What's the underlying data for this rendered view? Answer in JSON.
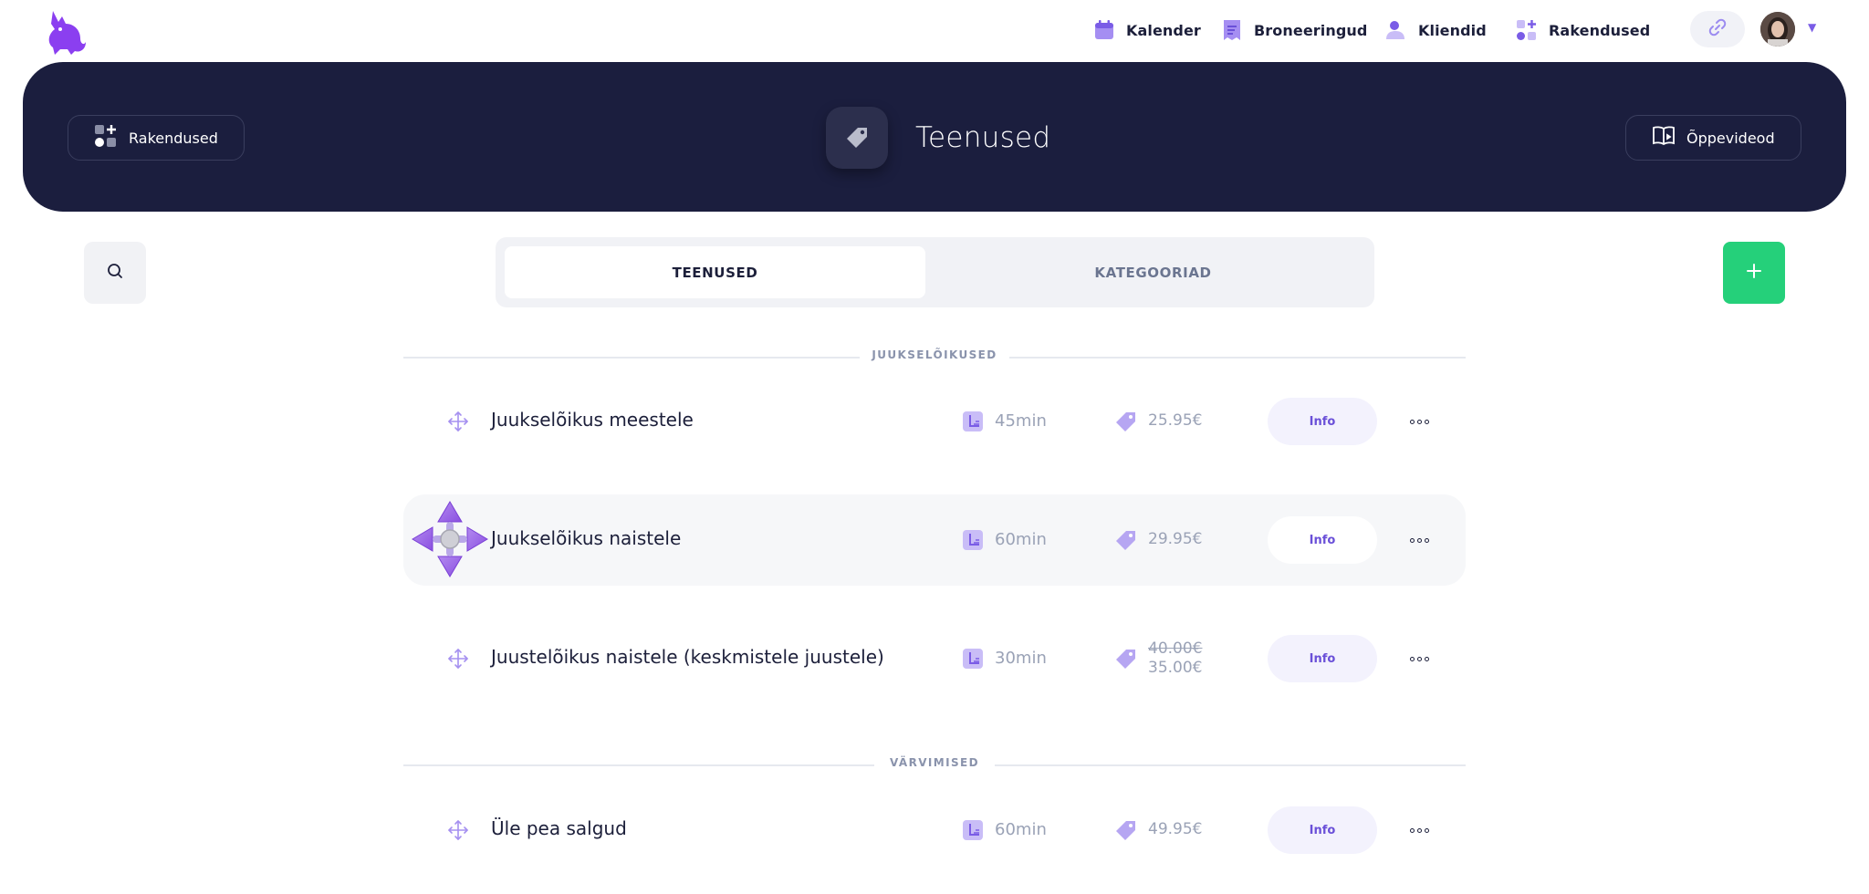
{
  "nav": {
    "items": [
      {
        "label": "Kalender",
        "icon": "calendar-icon"
      },
      {
        "label": "Broneeringud",
        "icon": "bookings-icon"
      },
      {
        "label": "Kliendid",
        "icon": "clients-icon"
      },
      {
        "label": "Rakendused",
        "icon": "apps-icon"
      }
    ],
    "link_icon": "link-icon",
    "accent": "#7a5ce6"
  },
  "banner": {
    "left_button": "Rakendused",
    "title": "Teenused",
    "right_button": "Õppevideod",
    "background": "#1b1e3e"
  },
  "tabs": [
    {
      "label": "TEENUSED",
      "active": true
    },
    {
      "label": "KATEGOORIAD",
      "active": false
    }
  ],
  "add_button_color": "#25d07a",
  "categories": [
    {
      "label": "JUUKSELÕIKUSED",
      "services": [
        {
          "name": "Juukselõikus meestele",
          "duration": "45min",
          "price": "25.95€"
        },
        {
          "name": "Juukselõikus naistele",
          "duration": "60min",
          "price": "29.95€"
        },
        {
          "name": "Juustelõikus naistele (keskmistele juustele)",
          "duration": "30min",
          "price_old": "40.00€",
          "price_new": "35.00€"
        }
      ]
    },
    {
      "label": "VÄRVIMISED",
      "services": [
        {
          "name": "Üle pea salgud",
          "duration": "60min",
          "price": "49.95€"
        }
      ]
    }
  ],
  "info_label": "Info"
}
